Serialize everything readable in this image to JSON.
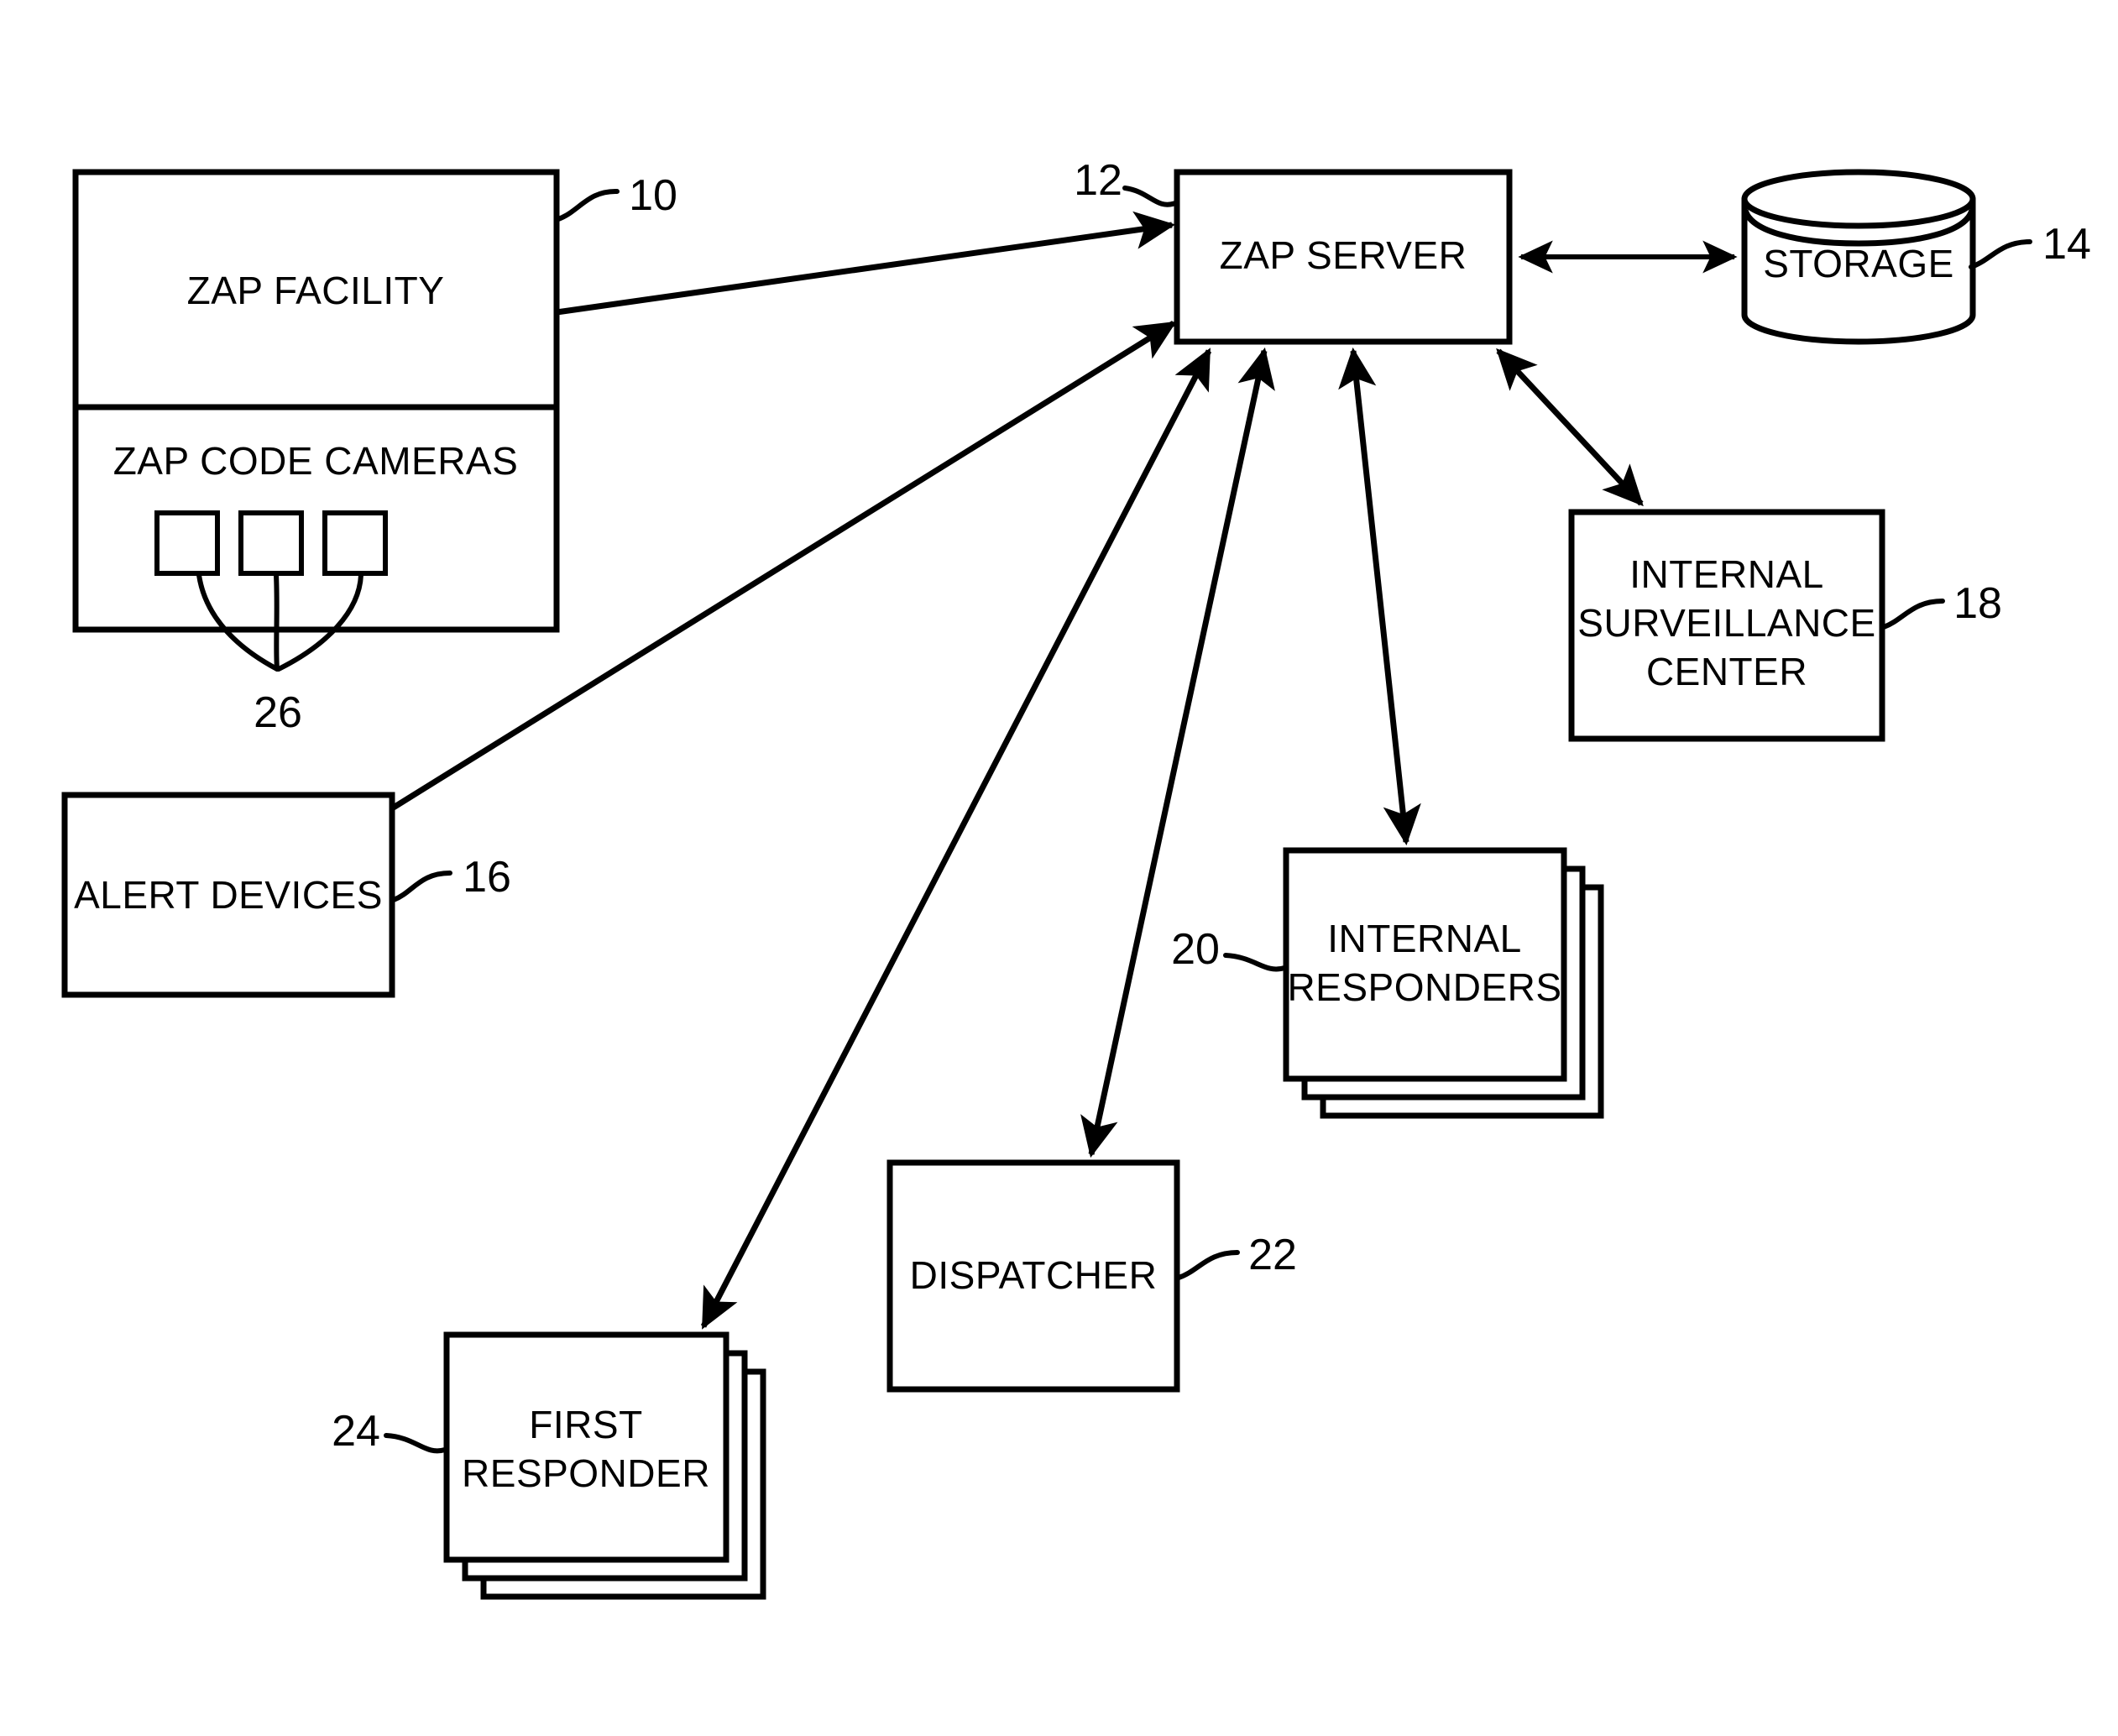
{
  "figure": {
    "type": "patent-block-diagram",
    "background_color": "#ffffff",
    "line_color": "#000000"
  },
  "nodes": {
    "zap_facility": {
      "label": "ZAP FACILITY",
      "ref": "10"
    },
    "zap_code_cameras": {
      "label": "ZAP CODE CAMERAS",
      "ref": "26",
      "camera_count": 3,
      "camera_label": "camera"
    },
    "zap_server": {
      "label": "ZAP SERVER",
      "ref": "12"
    },
    "storage": {
      "label": "STORAGE",
      "ref": "14",
      "shape": "cylinder"
    },
    "alert_devices": {
      "label": "ALERT DEVICES",
      "ref": "16"
    },
    "internal_surveillance_center": {
      "label_line1": "INTERNAL",
      "label_line2": "SURVEILLANCE",
      "label_line3": "CENTER",
      "ref": "18"
    },
    "internal_responders": {
      "label_line1": "INTERNAL",
      "label_line2": "RESPONDERS",
      "ref": "20",
      "stack_count": 3
    },
    "dispatcher": {
      "label": "DISPATCHER",
      "ref": "22"
    },
    "first_responder": {
      "label_line1": "FIRST",
      "label_line2": "RESPONDER",
      "ref": "24",
      "stack_count": 3
    }
  },
  "connections": [
    {
      "name": "facility-to-server",
      "from": "zap_facility",
      "to": "zap_server",
      "arrow": "single"
    },
    {
      "name": "server-to-storage",
      "from": "zap_server",
      "to": "storage",
      "arrow": "double"
    },
    {
      "name": "alert-devices-to-server",
      "from": "alert_devices",
      "to": "zap_server",
      "arrow": "single"
    },
    {
      "name": "server-to-surveillance-center",
      "from": "zap_server",
      "to": "internal_surveillance_center",
      "arrow": "double"
    },
    {
      "name": "server-to-internal-responders",
      "from": "zap_server",
      "to": "internal_responders",
      "arrow": "double"
    },
    {
      "name": "server-to-dispatcher",
      "from": "zap_server",
      "to": "dispatcher",
      "arrow": "double"
    },
    {
      "name": "server-to-first-responder",
      "from": "zap_server",
      "to": "first_responder",
      "arrow": "double"
    }
  ]
}
